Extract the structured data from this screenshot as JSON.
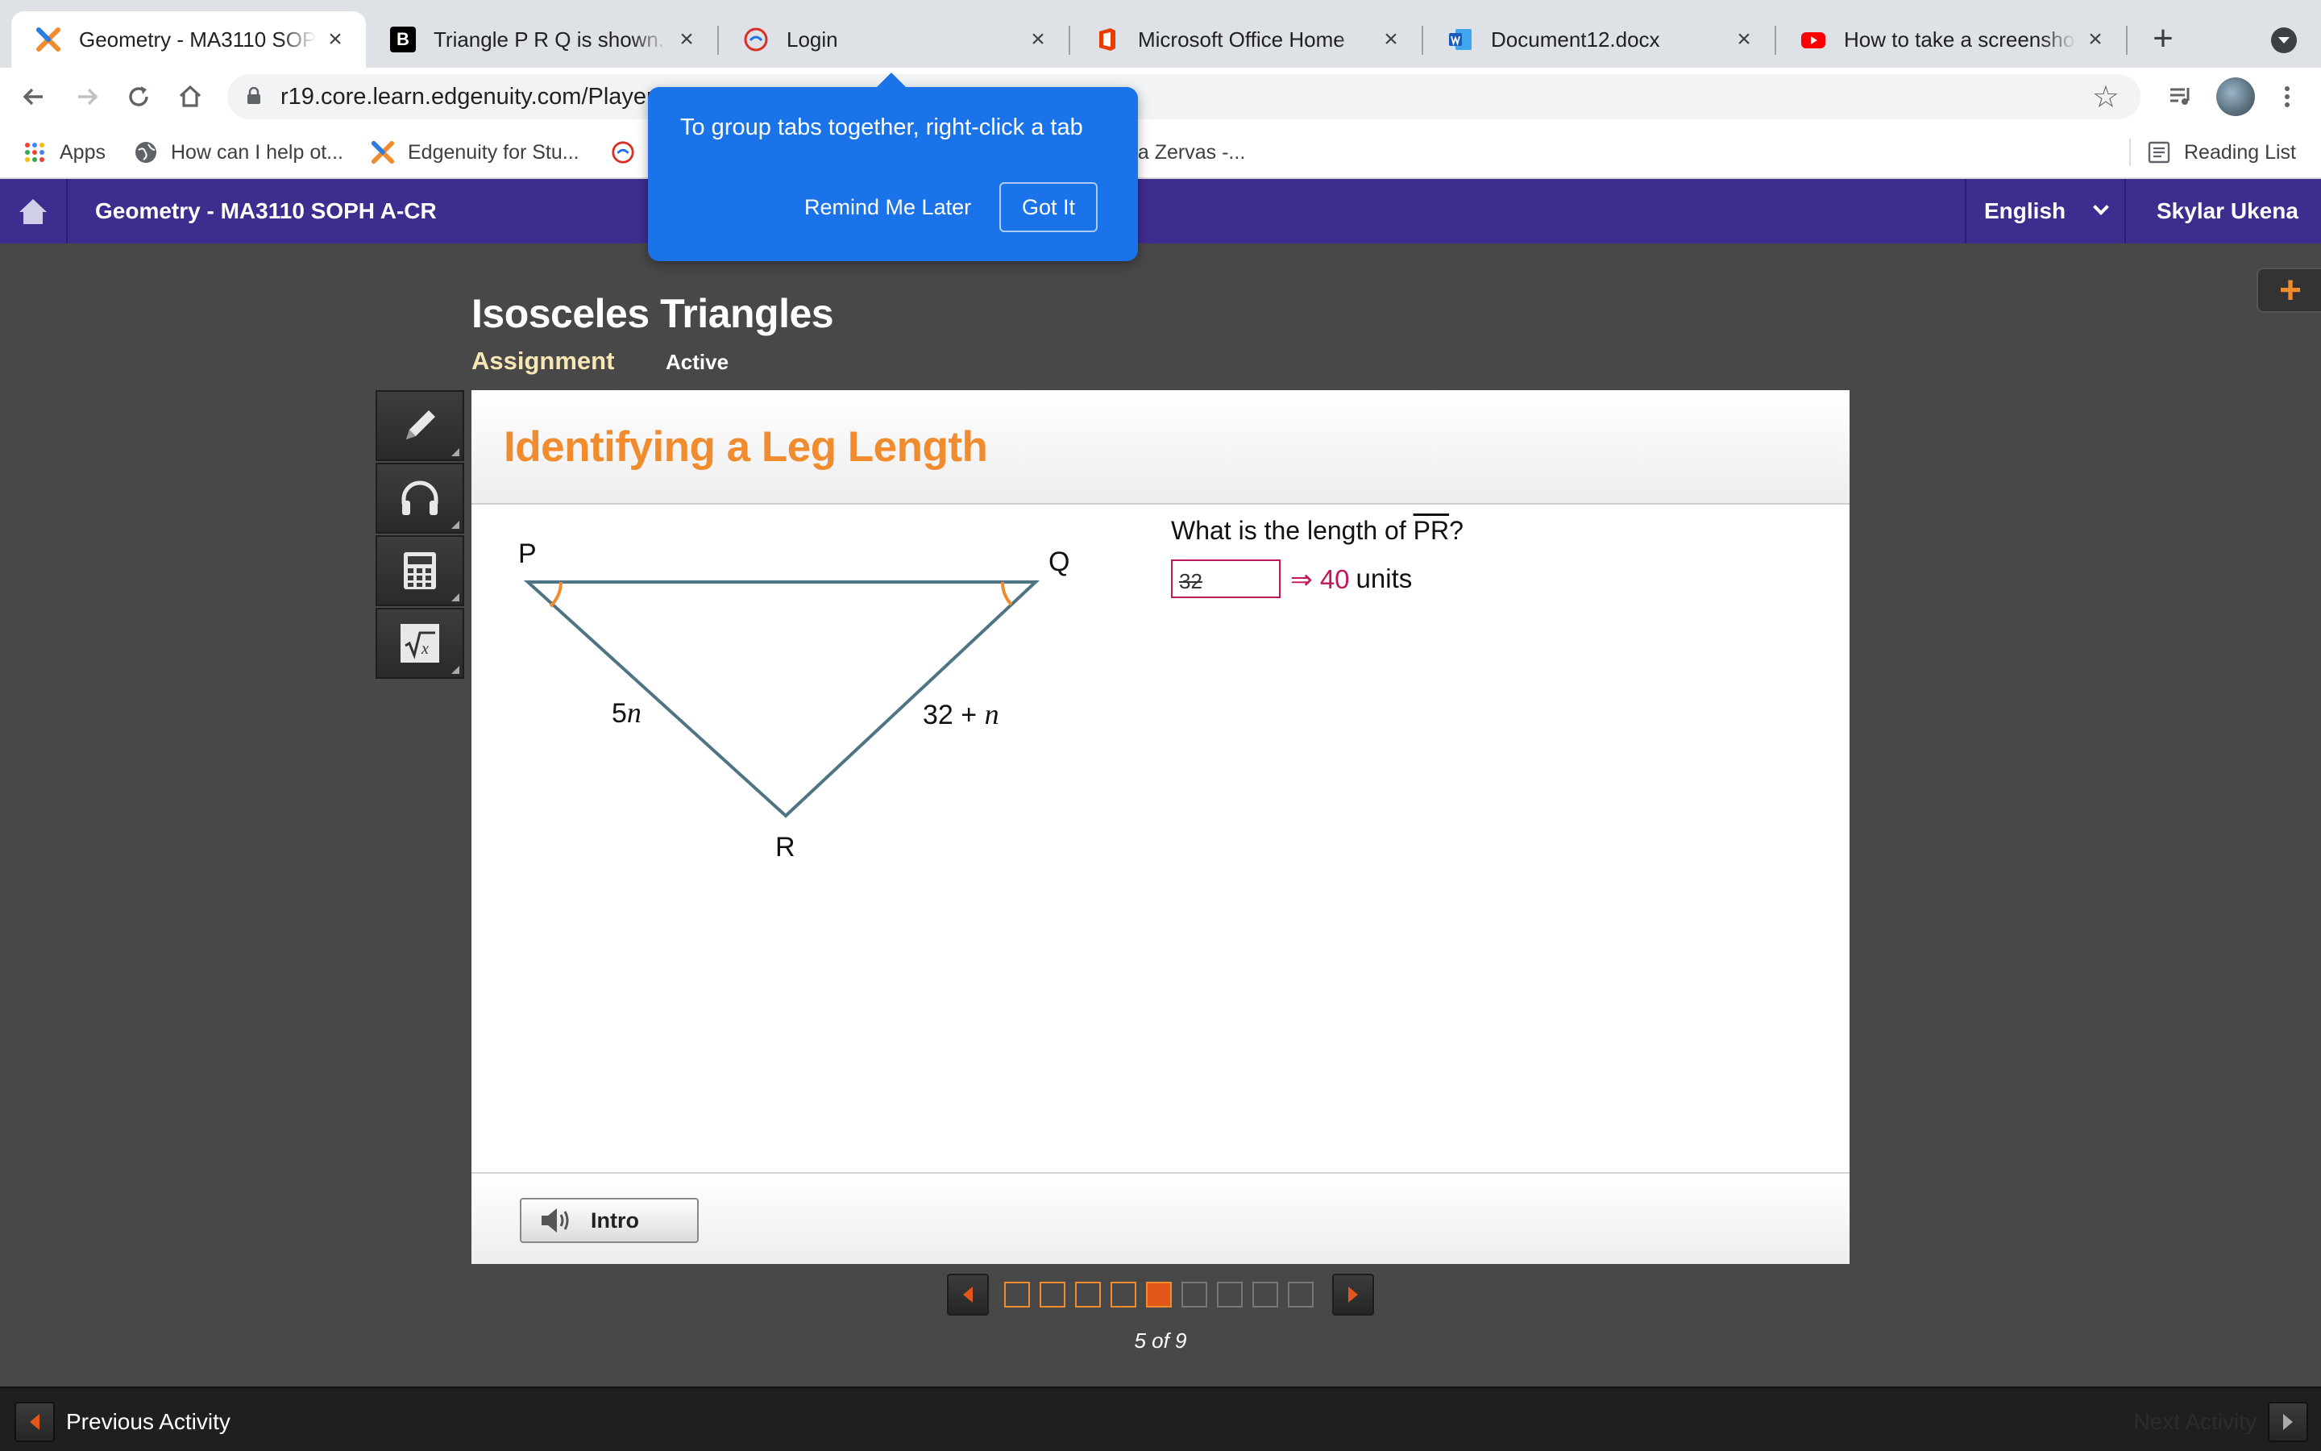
{
  "browser": {
    "tabs": [
      {
        "title": "Geometry - MA3110 SOPH A-CR",
        "icon": "edgenuity-icon",
        "active": true
      },
      {
        "title": "Triangle P R Q is shown. The",
        "icon": "brainly-icon",
        "active": false
      },
      {
        "title": "Login",
        "icon": "login-icon",
        "active": false
      },
      {
        "title": "Microsoft Office Home",
        "icon": "office-icon",
        "active": false
      },
      {
        "title": "Document12.docx",
        "icon": "word-icon",
        "active": false
      },
      {
        "title": "How to take a screenshot on",
        "icon": "youtube-icon",
        "active": false
      }
    ],
    "close_glyph": "×",
    "new_tab_glyph": "+",
    "url": "r19.core.learn.edgenuity.com/Player/",
    "bookmarks": [
      {
        "label": "Apps",
        "icon": "apps-grid-icon"
      },
      {
        "label": "How can I help ot...",
        "icon": "globe-icon"
      },
      {
        "label": "Edgenuity for Stu...",
        "icon": "edgenuity-icon"
      },
      {
        "label": "",
        "icon": "login-icon"
      },
      {
        "label": "na Zervas -...",
        "icon": ""
      }
    ],
    "reading_list": "Reading List",
    "tab_tip": {
      "text": "To group tabs together, right-click a tab",
      "remind_label": "Remind Me Later",
      "got_it_label": "Got It"
    }
  },
  "app": {
    "course_title": "Geometry - MA3110 SOPH A-CR",
    "language": "English",
    "user_name": "Skylar Ukena",
    "lesson_title": "Isosceles Triangles",
    "assignment_label": "Assignment",
    "status": "Active",
    "plus_glyph": "+"
  },
  "activity": {
    "title": "Identifying a Leg Length",
    "figure": {
      "vertices": {
        "p": "P",
        "q": "Q",
        "r": "R"
      },
      "side_pr": "5",
      "side_pr_var": "n",
      "side_qr": "32 + ",
      "side_qr_var": "n"
    },
    "question_prefix": "What is the length of ",
    "question_segment": "PR",
    "question_suffix": "?",
    "answer_entered": "32",
    "correction": "⇒ 40",
    "units": "units",
    "intro_label": "Intro"
  },
  "pagination": {
    "current": 5,
    "total": 9,
    "status_text": "5 of 9"
  },
  "bottom": {
    "prev_label": "Previous Activity",
    "next_label": "Next Activity"
  },
  "colors": {
    "header_purple": "#3d2d8f",
    "accent_orange": "#f08c2e",
    "answer_magenta": "#c2185b",
    "tip_blue": "#1a73e8"
  }
}
